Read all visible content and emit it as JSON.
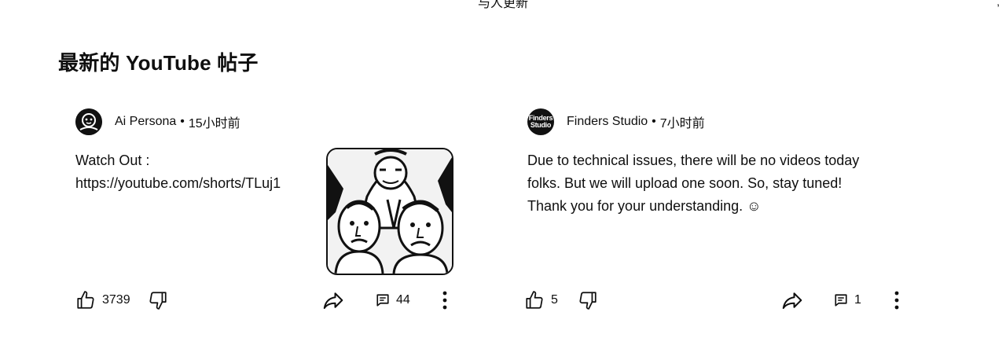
{
  "top_label": "与人更新",
  "section": {
    "title": "最新的 YouTube 帖子"
  },
  "posts": [
    {
      "author": "Ai Persona",
      "separator": "•",
      "time": "15小时前",
      "text_lines": [
        "Watch Out :",
        "https://youtube.com/shorts/TLuj1"
      ],
      "likes": "3739",
      "comments": "44",
      "icons": [
        "thumbs-up-icon",
        "thumbs-down-icon",
        "share-icon",
        "comment-icon",
        "more-vert-icon"
      ]
    },
    {
      "author": "Finders Studio",
      "avatar_text": [
        "Finders",
        "Studio"
      ],
      "separator": "•",
      "time": "7小时前",
      "text_lines": [
        "Due to technical issues, there will be no videos today",
        "folks. But we will upload one soon. So, stay tuned!",
        "Thank you for your understanding. ☺"
      ],
      "likes": "5",
      "comments": "1",
      "icons": [
        "thumbs-up-icon",
        "thumbs-down-icon",
        "share-icon",
        "comment-icon",
        "more-vert-icon"
      ]
    }
  ]
}
